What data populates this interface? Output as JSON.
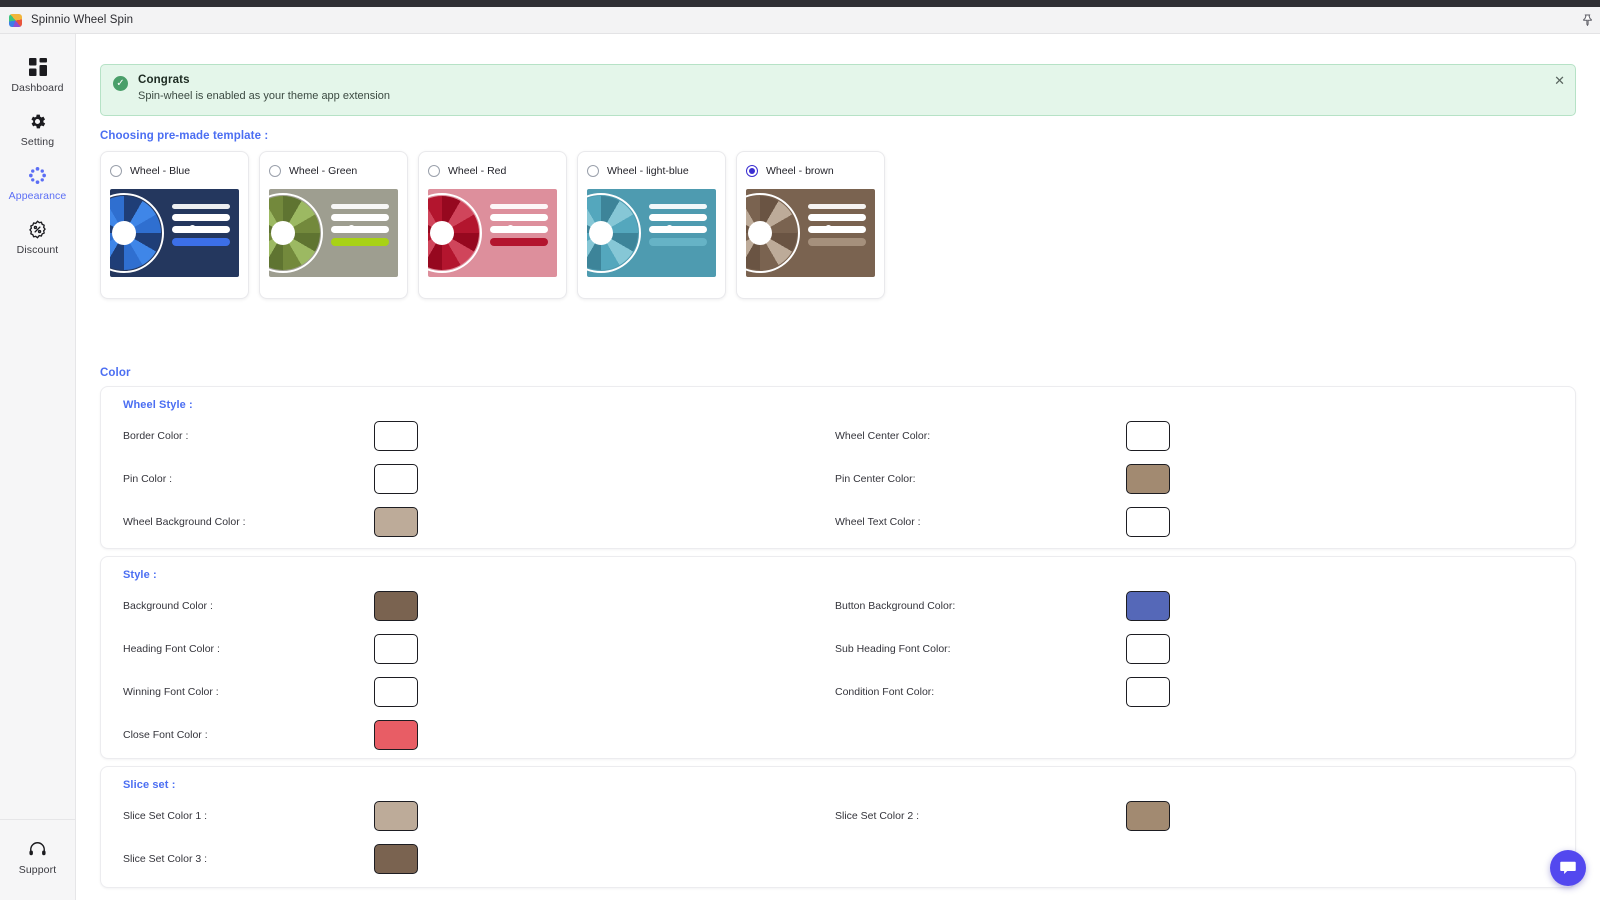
{
  "window": {
    "app_title": "Spinnio Wheel Spin",
    "logo_icon": "spinnio-logo-icon",
    "pin_icon": "pin-icon"
  },
  "sidebar": {
    "items": [
      {
        "label": "Dashboard",
        "icon": "dashboard-icon",
        "active": false
      },
      {
        "label": "Setting",
        "icon": "gear-icon",
        "active": false
      },
      {
        "label": "Appearance",
        "icon": "palette-icon",
        "active": true
      },
      {
        "label": "Discount",
        "icon": "discount-icon",
        "active": false
      }
    ],
    "bottom": {
      "label": "Support",
      "icon": "headset-icon"
    }
  },
  "banner": {
    "title": "Congrats",
    "message": "Spin-wheel is enabled as your theme app extension",
    "check_icon": "check-circle-icon",
    "close_icon": "close-icon",
    "background": "#e4f6ea",
    "border": "#b6e2c6"
  },
  "templates": {
    "heading": "Choosing pre-made template :",
    "items": [
      {
        "label": "Wheel - Blue",
        "selected": false,
        "panel_bg": "#24375e",
        "slice_a": "#2f6fd0",
        "slice_b": "#3f86e8",
        "slice_c": "#1f3e77",
        "cta": "#3c6fe8",
        "bar": "#ffffff"
      },
      {
        "label": "Wheel - Green",
        "selected": false,
        "panel_bg": "#9e9e90",
        "slice_a": "#73893c",
        "slice_b": "#9cb962",
        "slice_c": "#5f7431",
        "cta": "#a8d216",
        "bar": "#ffffff"
      },
      {
        "label": "Wheel - Red",
        "selected": false,
        "panel_bg": "#dd8f9c",
        "slice_a": "#b3152e",
        "slice_b": "#d0455b",
        "slice_c": "#96081f",
        "cta": "#b3152e",
        "bar": "#ffffff"
      },
      {
        "label": "Wheel - light-blue",
        "selected": false,
        "panel_bg": "#4e9bb0",
        "slice_a": "#54a7bd",
        "slice_b": "#86c7d6",
        "slice_c": "#3d8499",
        "cta": "#66b3c6",
        "bar": "#ffffff"
      },
      {
        "label": "Wheel - brown",
        "selected": true,
        "panel_bg": "#7a6350",
        "slice_a": "#7a6350",
        "slice_b": "#bdab99",
        "slice_c": "#6a5443",
        "cta": "#a5907c",
        "bar": "#ffffff"
      }
    ]
  },
  "color": {
    "heading": "Color",
    "wheel_style": {
      "heading": "Wheel Style :",
      "fields": [
        {
          "label": "Border Color :",
          "value": "#ffffff",
          "column": "left"
        },
        {
          "label": "Wheel Center Color:",
          "value": "#ffffff",
          "column": "right"
        },
        {
          "label": "Pin Color :",
          "value": "#ffffff",
          "column": "left"
        },
        {
          "label": "Pin Center Color:",
          "value": "#a28a71",
          "column": "right"
        },
        {
          "label": "Wheel Background Color :",
          "value": "#bdab99",
          "column": "left"
        },
        {
          "label": "Wheel Text Color :",
          "value": "#ffffff",
          "column": "right"
        }
      ]
    },
    "style": {
      "heading": "Style :",
      "fields": [
        {
          "label": "Background Color :",
          "value": "#7a6350",
          "column": "left"
        },
        {
          "label": "Button Background Color:",
          "value": "#5568b8",
          "column": "right"
        },
        {
          "label": "Heading Font Color :",
          "value": "#ffffff",
          "column": "left"
        },
        {
          "label": "Sub Heading Font Color:",
          "value": "#ffffff",
          "column": "right"
        },
        {
          "label": "Winning Font Color :",
          "value": "#ffffff",
          "column": "left"
        },
        {
          "label": "Condition Font Color:",
          "value": "#ffffff",
          "column": "right"
        },
        {
          "label": "Close Font Color :",
          "value": "#e85d65",
          "column": "left"
        }
      ]
    },
    "slice_set": {
      "heading": "Slice set :",
      "fields": [
        {
          "label": "Slice Set Color 1 :",
          "value": "#bdab99",
          "column": "left"
        },
        {
          "label": "Slice Set Color 2 :",
          "value": "#a28a71",
          "column": "right"
        },
        {
          "label": "Slice Set Color 3 :",
          "value": "#7a6350",
          "column": "left"
        }
      ]
    }
  },
  "chat": {
    "icon": "chat-bubble-icon",
    "color": "#5348ef"
  }
}
